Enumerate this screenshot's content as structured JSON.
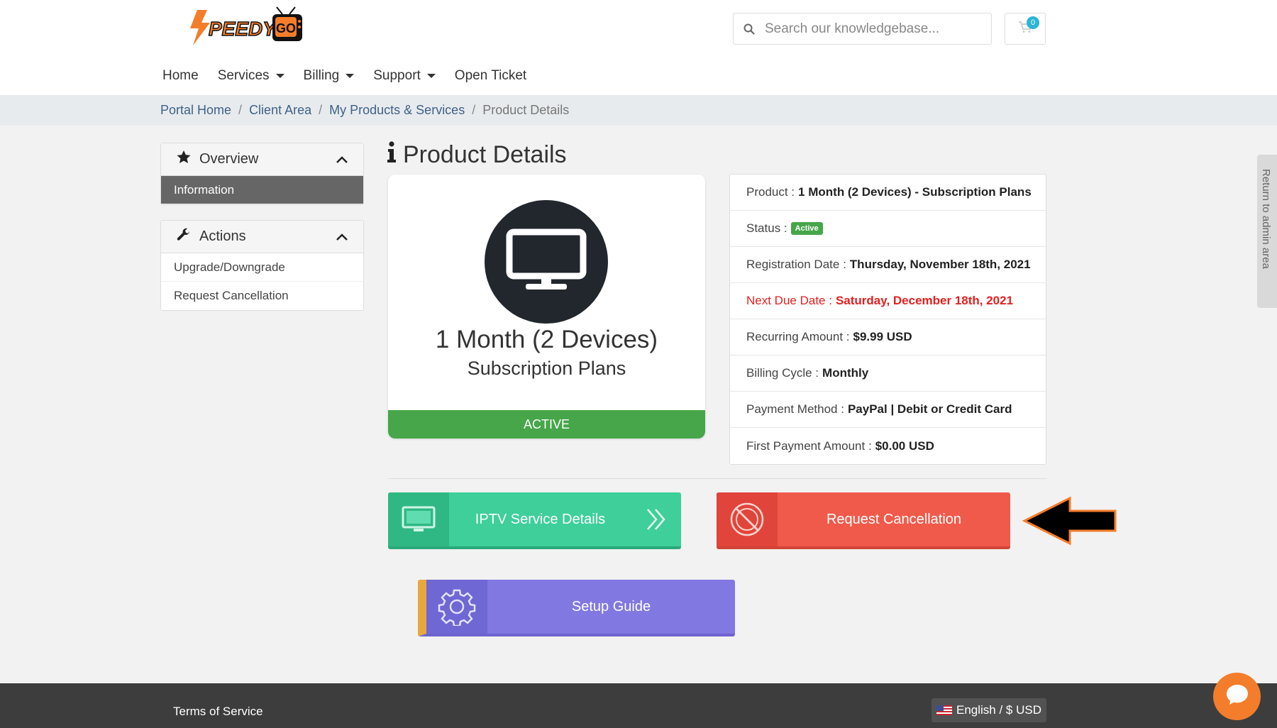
{
  "brand": {
    "logo_text": "SPEEDYGO"
  },
  "search": {
    "placeholder": "Search our knowledgebase..."
  },
  "cart": {
    "count": "0"
  },
  "nav": [
    {
      "label": "Home"
    },
    {
      "label": "Services"
    },
    {
      "label": "Billing"
    },
    {
      "label": "Support"
    },
    {
      "label": "Open Ticket"
    }
  ],
  "breadcrumb": [
    "Portal Home",
    "Client Area",
    "My Products & Services",
    "Product Details"
  ],
  "sidebar": {
    "overview": {
      "title": "Overview",
      "items": [
        "Information"
      ]
    },
    "actions": {
      "title": "Actions",
      "items": [
        "Upgrade/Downgrade",
        "Request Cancellation"
      ]
    }
  },
  "page": {
    "title": "Product Details"
  },
  "product_card": {
    "name": "1 Month (2 Devices)",
    "group": "Subscription Plans",
    "status": "ACTIVE"
  },
  "details": {
    "product_label": "Product :",
    "product_value": "1 Month (2 Devices) - Subscription Plans",
    "status_label": "Status :",
    "status_value": "Active",
    "reg_label": "Registration Date :",
    "reg_value": "Thursday, November 18th, 2021",
    "due_label": "Next Due Date :",
    "due_value": "Saturday, December 18th, 2021",
    "recurring_label": "Recurring Amount :",
    "recurring_value": "$9.99 USD",
    "cycle_label": "Billing Cycle :",
    "cycle_value": "Monthly",
    "payment_label": "Payment Method :",
    "payment_value": "PayPal | Debit or Credit Card",
    "first_label": "First Payment Amount :",
    "first_value": "$0.00 USD"
  },
  "buttons": {
    "iptv": "IPTV Service Details",
    "cancel": "Request Cancellation",
    "setup": "Setup Guide"
  },
  "admin_tab": "Return to admin area",
  "footer": {
    "tos": "Terms of Service",
    "language": "English / $ USD"
  },
  "colors": {
    "active_green": "#46a649",
    "iptv": "#3ecf9a",
    "cancel": "#f05a4b",
    "setup": "#8178e2",
    "due_red": "#e61e1e"
  }
}
